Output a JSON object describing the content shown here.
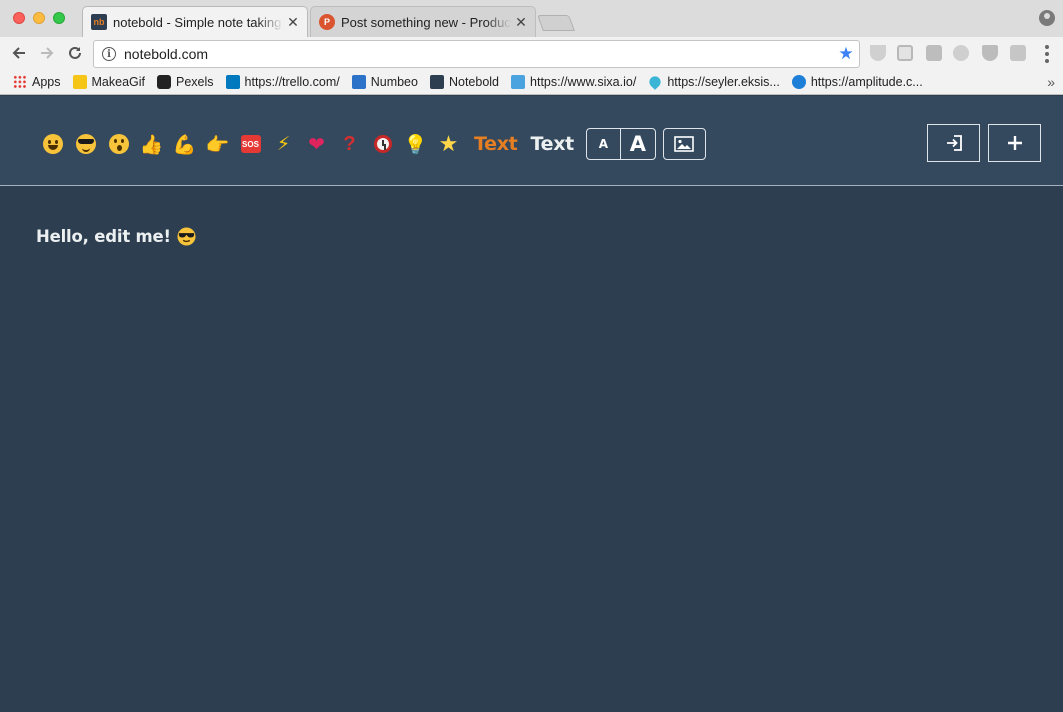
{
  "browser": {
    "tabs": [
      {
        "title": "notebold - Simple note taking app",
        "favicon": "nb",
        "close": "✕"
      },
      {
        "title": "Post something new - Product Hunt",
        "favicon": "P",
        "close": "✕"
      }
    ],
    "url": "notebold.com",
    "bookmarks": [
      {
        "label": "Apps",
        "icon": "apps-grid-icon"
      },
      {
        "label": "MakeaGif",
        "icon": "makeagif-icon"
      },
      {
        "label": "Pexels",
        "icon": "pexels-icon"
      },
      {
        "label": "https://trello.com/",
        "icon": "trello-icon"
      },
      {
        "label": "Numbeo",
        "icon": "numbeo-icon"
      },
      {
        "label": "Notebold",
        "icon": "notebold-icon"
      },
      {
        "label": "https://www.sixa.io/",
        "icon": "sixa-icon"
      },
      {
        "label": "https://seyler.eksis...",
        "icon": "droplet-icon"
      },
      {
        "label": "https://amplitude.c...",
        "icon": "amplitude-icon"
      }
    ],
    "bookmarks_more": "»"
  },
  "app": {
    "emojis": [
      {
        "name": "smiley",
        "glyph": ""
      },
      {
        "name": "sunglasses",
        "glyph": ""
      },
      {
        "name": "hushed",
        "glyph": ""
      },
      {
        "name": "thumbs-up",
        "glyph": "👍"
      },
      {
        "name": "flexed-biceps",
        "glyph": "💪"
      },
      {
        "name": "pointing-hand",
        "glyph": "👉"
      },
      {
        "name": "sos",
        "glyph": "SOS"
      },
      {
        "name": "high-voltage",
        "glyph": "⚡"
      },
      {
        "name": "heart",
        "glyph": "❤"
      },
      {
        "name": "question-mark",
        "glyph": "?"
      },
      {
        "name": "alarm-clock",
        "glyph": ""
      },
      {
        "name": "light-bulb",
        "glyph": "💡"
      },
      {
        "name": "star",
        "glyph": "★"
      }
    ],
    "text_orange": "Text",
    "text_white": "Text",
    "size_small": "A",
    "size_large": "A",
    "colors": {
      "background": "#2c3e50",
      "header": "#34495e",
      "accent": "#e67e22",
      "text": "#ecf0f1"
    },
    "note": {
      "text": "Hello, edit me!"
    }
  }
}
